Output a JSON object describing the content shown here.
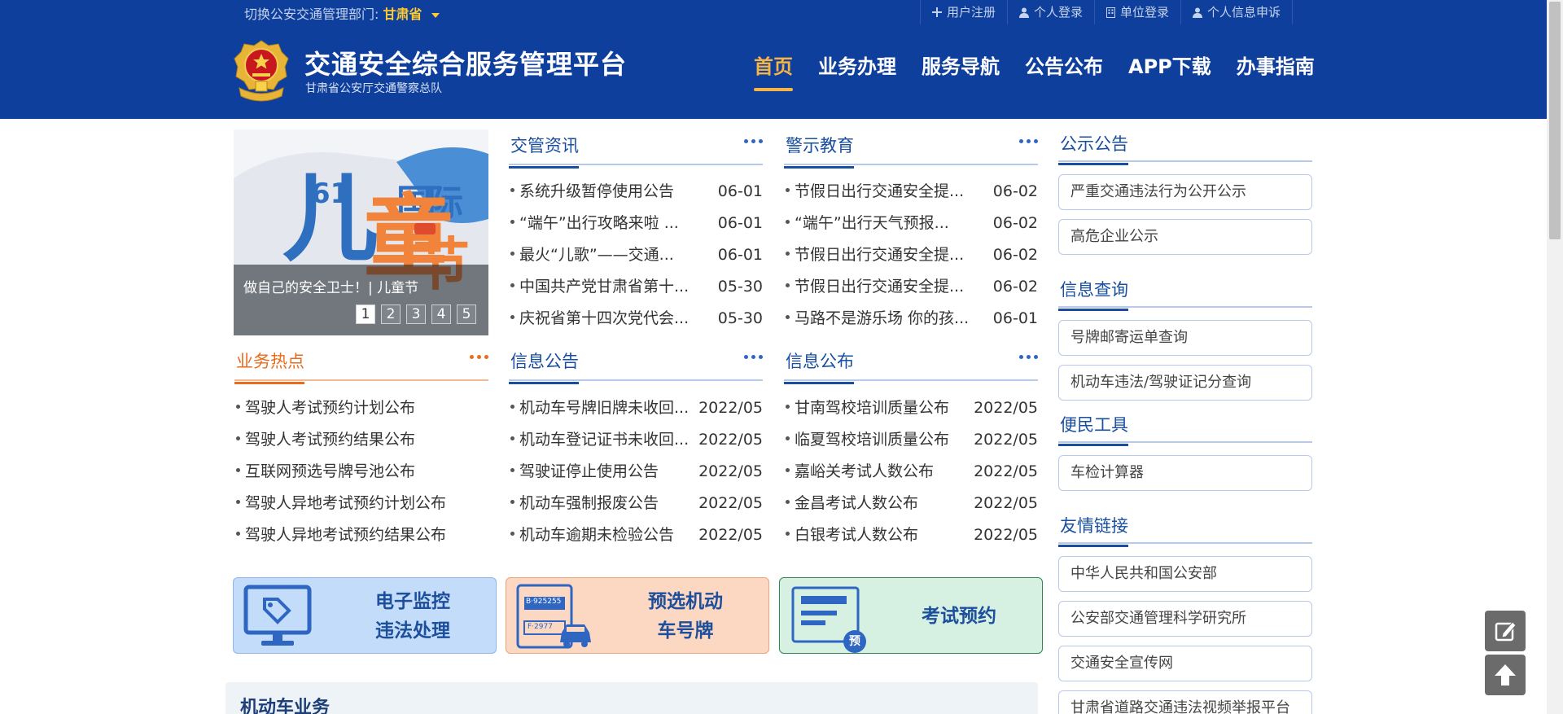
{
  "topbar": {
    "switch_label": "切换公安交通管理部门:",
    "province": "甘肃省",
    "links": [
      {
        "icon": "plus-icon",
        "label": "用户注册"
      },
      {
        "icon": "user-icon",
        "label": "个人登录"
      },
      {
        "icon": "building-icon",
        "label": "单位登录"
      },
      {
        "icon": "user-icon",
        "label": "个人信息申诉"
      }
    ]
  },
  "header": {
    "title": "交通安全综合服务管理平台",
    "subtitle": "甘肃省公安厅交通警察总队",
    "nav": [
      "首页",
      "业务办理",
      "服务导航",
      "公告公布",
      "APP下载",
      "办事指南"
    ]
  },
  "carousel": {
    "caption": "做自己的安全卫士！| 儿童节",
    "dots": [
      "1",
      "2",
      "3",
      "4",
      "5"
    ]
  },
  "news": {
    "title": "交管资讯",
    "items": [
      {
        "text": "系统升级暂停使用公告",
        "date": "06-01"
      },
      {
        "text": "“端午”出行攻略来啦 ...",
        "date": "06-01"
      },
      {
        "text": "最火“儿歌”——交通...",
        "date": "06-01"
      },
      {
        "text": "中国共产党甘肃省第十...",
        "date": "05-30"
      },
      {
        "text": "庆祝省第十四次党代会...",
        "date": "05-30"
      }
    ]
  },
  "warning": {
    "title": "警示教育",
    "items": [
      {
        "text": "节假日出行交通安全提...",
        "date": "06-02"
      },
      {
        "text": "“端午”出行天气预报...",
        "date": "06-02"
      },
      {
        "text": "节假日出行交通安全提...",
        "date": "06-02"
      },
      {
        "text": "节假日出行交通安全提...",
        "date": "06-02"
      },
      {
        "text": "马路不是游乐场 你的孩...",
        "date": "06-01"
      }
    ]
  },
  "hot": {
    "title": "业务热点",
    "items": [
      "驾驶人考试预约计划公布",
      "驾驶人考试预约结果公布",
      "互联网预选号牌号池公布",
      "驾驶人异地考试预约计划公布",
      "驾驶人异地考试预约结果公布"
    ]
  },
  "notice": {
    "title": "信息公告",
    "items": [
      {
        "text": "机动车号牌旧牌未收回...",
        "date": "2022/05"
      },
      {
        "text": "机动车登记证书未收回...",
        "date": "2022/05"
      },
      {
        "text": "驾驶证停止使用公告",
        "date": "2022/05"
      },
      {
        "text": "机动车强制报废公告",
        "date": "2022/05"
      },
      {
        "text": "机动车逾期未检验公告",
        "date": "2022/05"
      }
    ]
  },
  "publish": {
    "title": "信息公布",
    "items": [
      {
        "text": "甘南驾校培训质量公布",
        "date": "2022/05"
      },
      {
        "text": "临夏驾校培训质量公布",
        "date": "2022/05"
      },
      {
        "text": "嘉峪关考试人数公布",
        "date": "2022/05"
      },
      {
        "text": "金昌考试人数公布",
        "date": "2022/05"
      },
      {
        "text": "白银考试人数公布",
        "date": "2022/05"
      }
    ]
  },
  "sidebar": {
    "public_notice": {
      "title": "公示公告",
      "items": [
        "严重交通违法行为公开公示",
        "高危企业公示"
      ]
    },
    "query": {
      "title": "信息查询",
      "items": [
        "号牌邮寄运单查询",
        "机动车违法/驾驶证记分查询"
      ]
    },
    "tools": {
      "title": "便民工具",
      "items": [
        "车检计算器"
      ]
    },
    "links": {
      "title": "友情链接",
      "items": [
        "中华人民共和国公安部",
        "公安部交通管理科学研究所",
        "交通安全宣传网",
        "甘肃省道路交通违法视频举报平台"
      ]
    }
  },
  "cards": [
    {
      "line1": "电子监控",
      "line2": "违法处理"
    },
    {
      "line1": "预选机动",
      "line2": "车号牌",
      "plate1": "B·925255",
      "plate2": "F·2977"
    },
    {
      "line1": "考试预约",
      "badge": "预"
    }
  ],
  "section": {
    "title": "机动车业务"
  },
  "colors": {
    "primary": "#0e3f9c",
    "accent": "#f6b445",
    "hot": "#ea6b1c"
  }
}
